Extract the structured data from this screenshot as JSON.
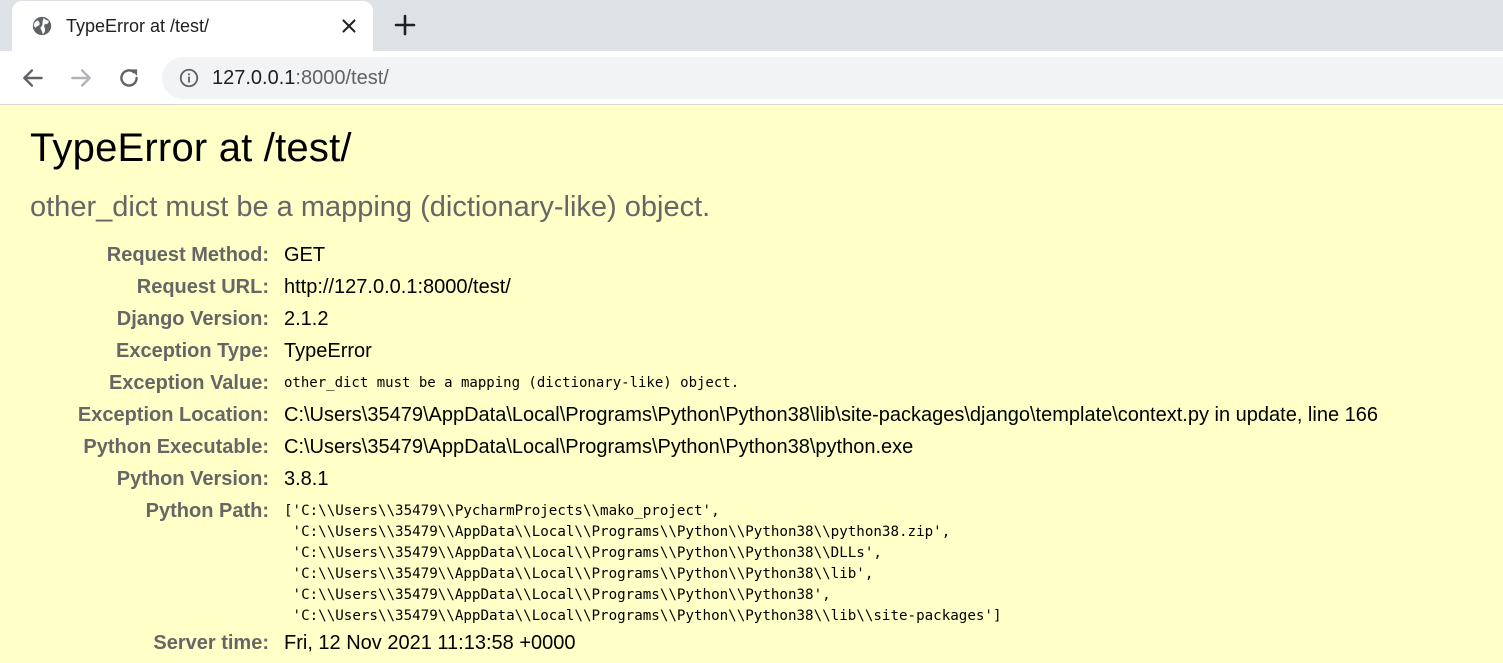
{
  "browser": {
    "tab_title": "TypeError at /test/",
    "url_host": "127.0.0.1",
    "url_rest": ":8000/test/",
    "icons": [
      "globe-icon",
      "close-icon",
      "plus-icon",
      "back-arrow-icon",
      "forward-arrow-icon",
      "reload-icon",
      "info-icon"
    ]
  },
  "error": {
    "title": "TypeError at /test/",
    "message": "other_dict must be a mapping (dictionary-like) object."
  },
  "meta": {
    "request_method_label": "Request Method:",
    "request_method": "GET",
    "request_url_label": "Request URL:",
    "request_url": "http://127.0.0.1:8000/test/",
    "django_version_label": "Django Version:",
    "django_version": "2.1.2",
    "exception_type_label": "Exception Type:",
    "exception_type": "TypeError",
    "exception_value_label": "Exception Value:",
    "exception_value": "other_dict must be a mapping (dictionary-like) object.",
    "exception_location_label": "Exception Location:",
    "exception_location": "C:\\Users\\35479\\AppData\\Local\\Programs\\Python\\Python38\\lib\\site-packages\\django\\template\\context.py in update, line 166",
    "python_executable_label": "Python Executable:",
    "python_executable": "C:\\Users\\35479\\AppData\\Local\\Programs\\Python\\Python38\\python.exe",
    "python_version_label": "Python Version:",
    "python_version": "3.8.1",
    "python_path_label": "Python Path:",
    "python_path": [
      "['C:\\\\Users\\\\35479\\\\PycharmProjects\\\\mako_project',",
      " 'C:\\\\Users\\\\35479\\\\AppData\\\\Local\\\\Programs\\\\Python\\\\Python38\\\\python38.zip',",
      " 'C:\\\\Users\\\\35479\\\\AppData\\\\Local\\\\Programs\\\\Python\\\\Python38\\\\DLLs',",
      " 'C:\\\\Users\\\\35479\\\\AppData\\\\Local\\\\Programs\\\\Python\\\\Python38\\\\lib',",
      " 'C:\\\\Users\\\\35479\\\\AppData\\\\Local\\\\Programs\\\\Python\\\\Python38',",
      " 'C:\\\\Users\\\\35479\\\\AppData\\\\Local\\\\Programs\\\\Python\\\\Python38\\\\lib\\\\site-packages']"
    ],
    "server_time_label": "Server time:",
    "server_time": "Fri, 12 Nov 2021 11:13:58 +0000"
  }
}
